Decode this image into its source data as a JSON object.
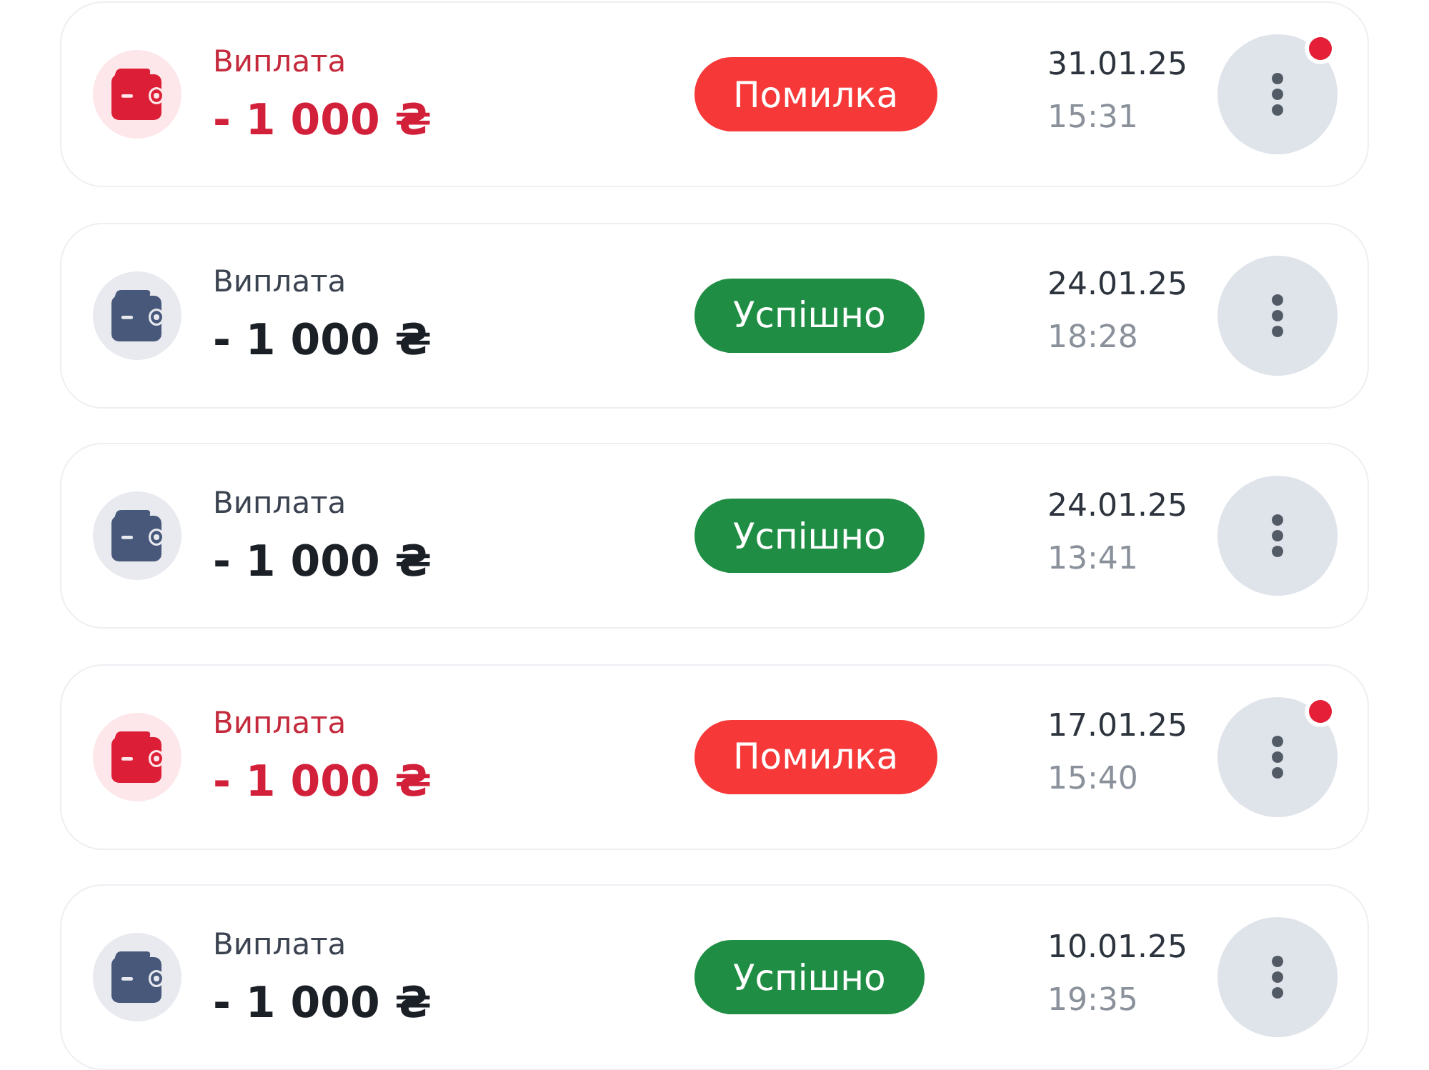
{
  "transactions": [
    {
      "label": "Виплата",
      "amount": "- 1 000 ₴",
      "status": "Помилка",
      "kind": "error",
      "date": "31.01.25",
      "time": "15:31",
      "has_notification": true
    },
    {
      "label": "Виплата",
      "amount": "- 1 000 ₴",
      "status": "Успішно",
      "kind": "success",
      "date": "24.01.25",
      "time": "18:28",
      "has_notification": false
    },
    {
      "label": "Виплата",
      "amount": "- 1 000 ₴",
      "status": "Успішно",
      "kind": "success",
      "date": "24.01.25",
      "time": "13:41",
      "has_notification": false
    },
    {
      "label": "Виплата",
      "amount": "- 1 000 ₴",
      "status": "Помилка",
      "kind": "error",
      "date": "17.01.25",
      "time": "15:40",
      "has_notification": true
    },
    {
      "label": "Виплата",
      "amount": "- 1 000 ₴",
      "status": "Успішно",
      "kind": "success",
      "date": "10.01.25",
      "time": "19:35",
      "has_notification": false
    }
  ]
}
